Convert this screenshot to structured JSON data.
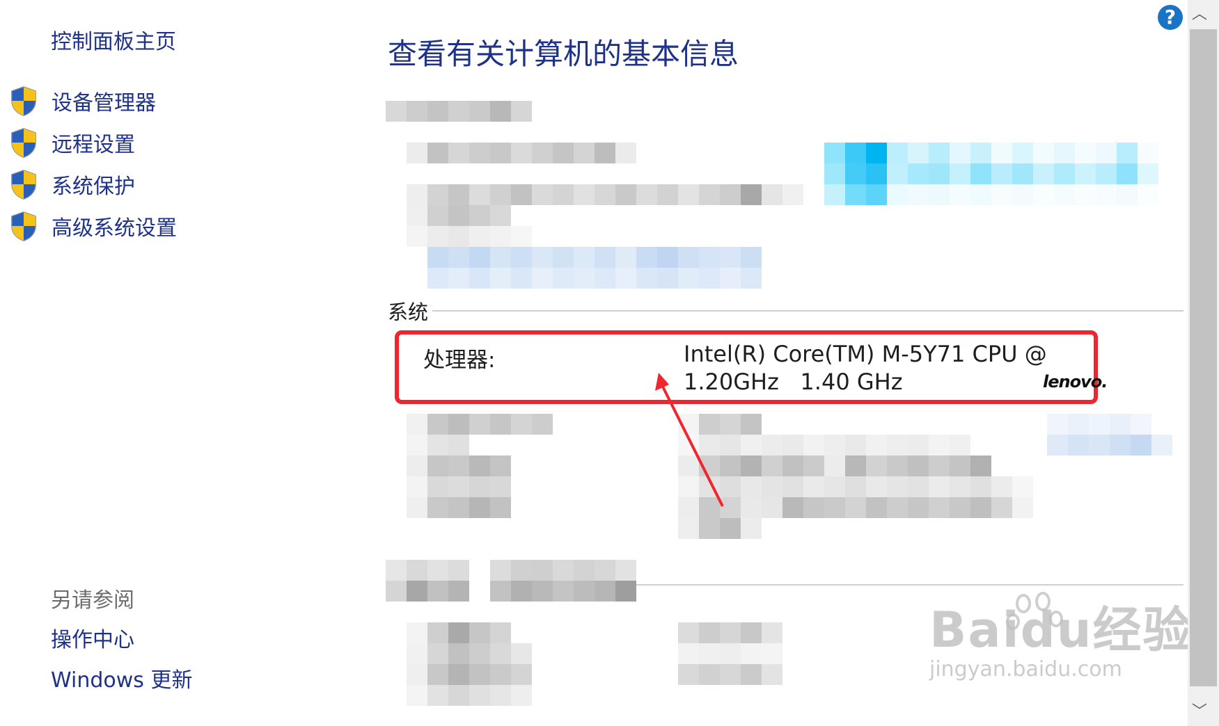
{
  "left_nav": {
    "home": "控制面板主页",
    "tasks": [
      {
        "label": "设备管理器",
        "icon": "shield-icon"
      },
      {
        "label": "远程设置",
        "icon": "shield-icon"
      },
      {
        "label": "系统保护",
        "icon": "shield-icon"
      },
      {
        "label": "高级系统设置",
        "icon": "shield-icon"
      }
    ],
    "see_also": "另请参阅",
    "links": [
      "操作中心",
      "Windows 更新"
    ]
  },
  "main": {
    "title": "查看有关计算机的基本信息",
    "system_section": "系统",
    "processor_label": "处理器:",
    "processor_line1": "Intel(R) Core(TM) M-5Y71 CPU @",
    "processor_line2": "1.20GHz   1.40 GHz",
    "oem_logo_text": "lenovo."
  },
  "help": "?",
  "watermark": {
    "main": "Baidu经验",
    "sub": "jingyan.baidu.com"
  },
  "colors": {
    "link": "#1e3287",
    "highlight": "#f0252d",
    "help": "#1a73c4"
  }
}
